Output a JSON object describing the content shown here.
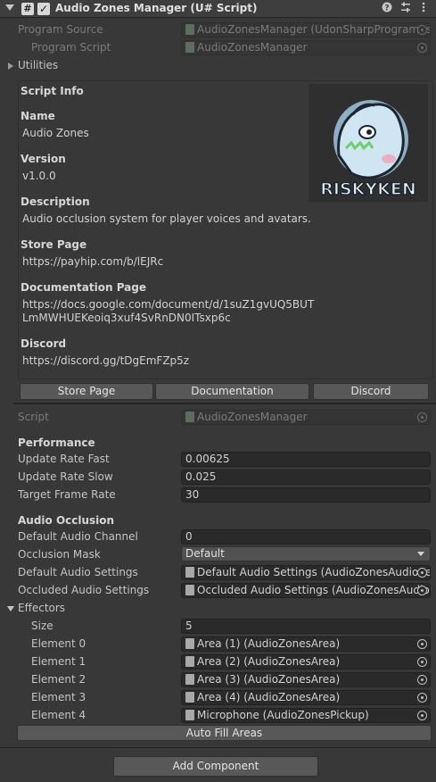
{
  "header": {
    "title": "Audio Zones Manager (U# Script)",
    "script_icon": "#",
    "check_mark": "✓",
    "icons": [
      "help-icon",
      "presets-icon",
      "more-icon"
    ]
  },
  "program": {
    "source_label": "Program Source",
    "source_value": "AudioZonesManager (UdonSharpProgramAsset)",
    "script_label": "Program Script",
    "script_value": "AudioZonesManager"
  },
  "utilities": {
    "label": "Utilities"
  },
  "script_info": {
    "heading": "Script Info",
    "name_label": "Name",
    "name_value": "Audio Zones",
    "version_label": "Version",
    "version_value": "v1.0.0",
    "description_label": "Description",
    "description_value": "Audio occlusion system for player voices and avatars.",
    "store_label": "Store Page",
    "store_value": "https://payhip.com/b/lEJRc",
    "docs_label": "Documentation Page",
    "docs_value_1": "https://docs.google.com/document/d/1suZ1gvUQ5BUT",
    "docs_value_2": "LmMWHUEKeoiq3xuf4SvRnDN0ITsxp6c",
    "discord_label": "Discord",
    "discord_value": "https://discord.gg/tDgEmFZp5z",
    "logo_text": "RISKYKEN",
    "buttons": {
      "store": "Store Page",
      "documentation": "Documentation",
      "discord": "Discord"
    }
  },
  "script": {
    "label": "Script",
    "value": "AudioZonesManager"
  },
  "performance": {
    "heading": "Performance",
    "rows": [
      {
        "label": "Update Rate Fast",
        "value": "0.00625"
      },
      {
        "label": "Update Rate Slow",
        "value": "0.025"
      },
      {
        "label": "Target Frame Rate",
        "value": "30"
      }
    ]
  },
  "audio_occlusion": {
    "heading": "Audio Occlusion",
    "default_channel_label": "Default Audio Channel",
    "default_channel_value": "0",
    "mask_label": "Occlusion Mask",
    "mask_value": "Default",
    "default_settings_label": "Default Audio Settings",
    "default_settings_value": "Default Audio Settings (AudioZonesAudioSettings)",
    "occluded_settings_label": "Occluded Audio Settings",
    "occluded_settings_value": "Occluded Audio Settings (AudioZonesAudioSettings)"
  },
  "effectors": {
    "label": "Effectors",
    "size_label": "Size",
    "size_value": "5",
    "elements": [
      {
        "label": "Element 0",
        "value": "Area (1) (AudioZonesArea)"
      },
      {
        "label": "Element 1",
        "value": "Area (2) (AudioZonesArea)"
      },
      {
        "label": "Element 2",
        "value": "Area (3) (AudioZonesArea)"
      },
      {
        "label": "Element 3",
        "value": "Area (4) (AudioZonesArea)"
      },
      {
        "label": "Element 4",
        "value": "Microphone (AudioZonesPickup)"
      }
    ],
    "autofill_button": "Auto Fill Areas"
  },
  "add_component": "Add Component"
}
